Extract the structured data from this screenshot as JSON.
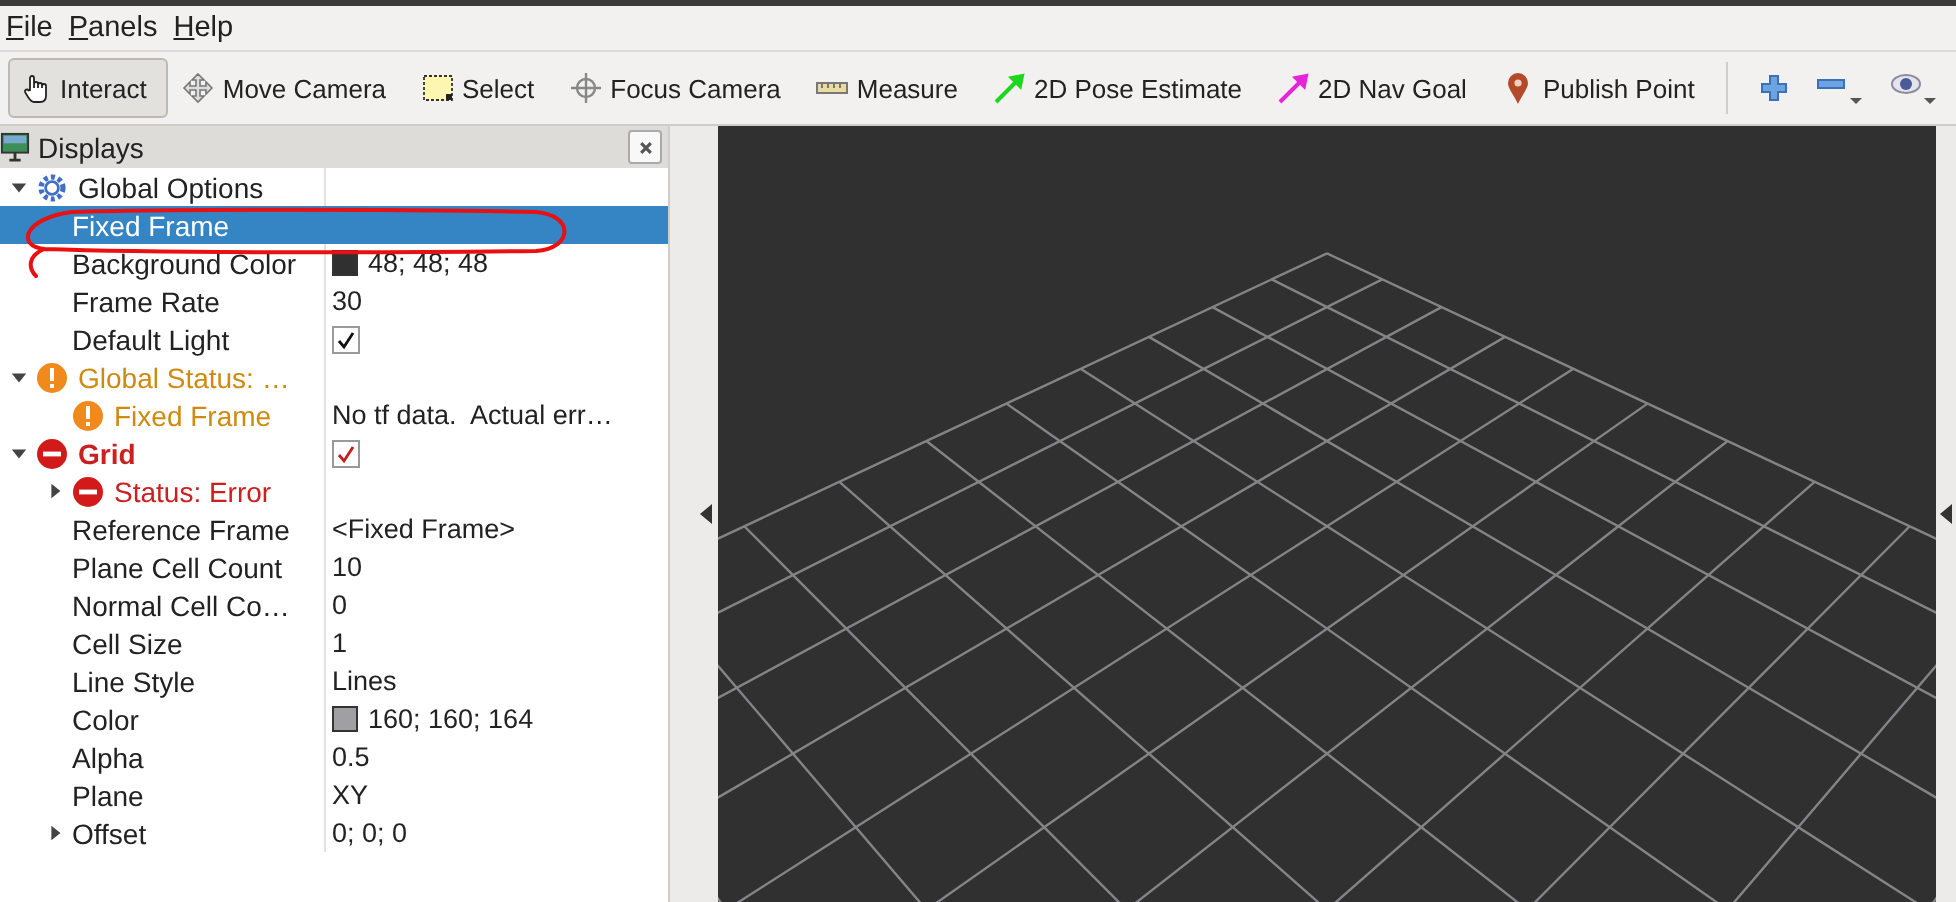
{
  "menu": [
    {
      "label": "File"
    },
    {
      "label": "Panels"
    },
    {
      "label": "Help"
    }
  ],
  "tools": [
    {
      "label": "Interact",
      "kind": "interact",
      "selected": true
    },
    {
      "label": "Move Camera",
      "kind": "move",
      "selected": false
    },
    {
      "label": "Select",
      "kind": "select",
      "selected": false
    },
    {
      "label": "Focus Camera",
      "kind": "focus",
      "selected": false
    },
    {
      "label": "Measure",
      "kind": "measure",
      "selected": false
    },
    {
      "label": "2D Pose Estimate",
      "kind": "pose",
      "selected": false
    },
    {
      "label": "2D Nav Goal",
      "kind": "goal",
      "selected": false
    },
    {
      "label": "Publish Point",
      "kind": "point",
      "selected": false
    }
  ],
  "view_buttons": [
    {
      "kind": "add"
    },
    {
      "kind": "remove"
    },
    {
      "kind": "eye"
    }
  ],
  "displays": {
    "title": "Displays",
    "items": [
      {
        "label": "Global Options",
        "kind": "options",
        "expanded": true,
        "selected": false,
        "children": [
          {
            "label": "Fixed Frame",
            "kind": "property",
            "selected": true
          },
          {
            "label": "Background Color",
            "kind": "property",
            "selected": false,
            "value": "48; 48; 48",
            "color": "#303030"
          },
          {
            "label": "Frame Rate",
            "kind": "property",
            "selected": false,
            "value": "30"
          },
          {
            "label": "Default Light",
            "kind": "property",
            "selected": false,
            "checked": true
          }
        ]
      },
      {
        "label": "Global Status: …",
        "kind": "warning",
        "expanded": true,
        "selected": false,
        "children": [
          {
            "label": "Fixed Frame",
            "kind": "warning",
            "selected": false,
            "value": "No tf data.  Actual err…"
          }
        ]
      },
      {
        "label": "Grid",
        "kind": "error",
        "expanded": true,
        "selected": false,
        "checked": true,
        "children": [
          {
            "label": "Status: Error",
            "kind": "error",
            "expanded": false,
            "selected": false
          },
          {
            "label": "Reference Frame",
            "kind": "property",
            "selected": false,
            "value": "<Fixed Frame>"
          },
          {
            "label": "Plane Cell Count",
            "kind": "property",
            "selected": false,
            "value": "10"
          },
          {
            "label": "Normal Cell Co…",
            "kind": "property",
            "selected": false,
            "value": "0"
          },
          {
            "label": "Cell Size",
            "kind": "property",
            "selected": false,
            "value": "1"
          },
          {
            "label": "Line Style",
            "kind": "property",
            "selected": false,
            "value": "Lines"
          },
          {
            "label": "Color",
            "kind": "property",
            "selected": false,
            "value": "160; 160; 164",
            "color": "#a0a0a4"
          },
          {
            "label": "Alpha",
            "kind": "property",
            "selected": false,
            "value": "0.5"
          },
          {
            "label": "Plane",
            "kind": "property",
            "selected": false,
            "value": "XY"
          },
          {
            "label": "Offset",
            "kind": "property",
            "expanded": false,
            "selected": false,
            "value": "0; 0; 0"
          }
        ]
      }
    ]
  }
}
